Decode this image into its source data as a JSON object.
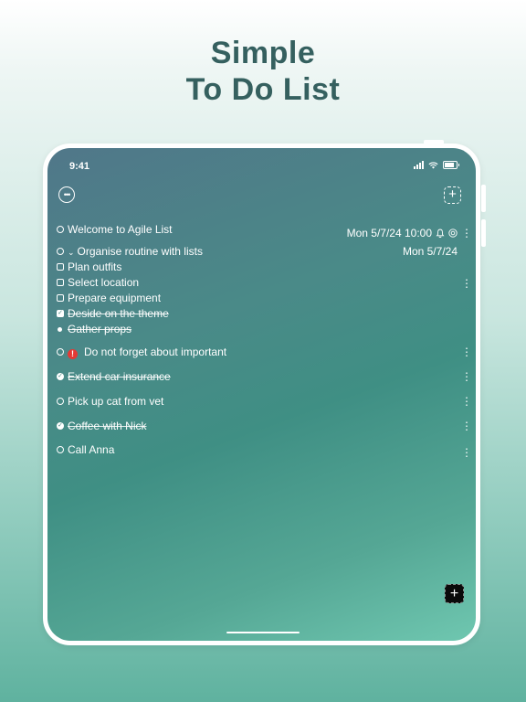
{
  "headline": {
    "line1": "Simple",
    "line2": "To Do List"
  },
  "status_bar": {
    "time": "9:41",
    "icons": [
      "signal-icon",
      "wifi-icon",
      "battery-icon"
    ]
  },
  "toolbar": {
    "more_icon": "ellipsis-icon",
    "add_icon": "plus-icon"
  },
  "tasks": [
    {
      "label": "Welcome to Agile List",
      "marker": "circle",
      "done": false,
      "date": "Mon 5/7/24 10:00",
      "has_alarm": true,
      "has_repeat": true
    },
    {
      "label": "Organise routine with lists",
      "marker": "circle",
      "done": false,
      "expanded": true,
      "date": "Mon 5/7/24"
    },
    {
      "label": "Plan outfits",
      "marker": "square",
      "done": false,
      "subtask": true
    },
    {
      "label": "Select location",
      "marker": "square",
      "done": false,
      "subtask": true
    },
    {
      "label": "Prepare equipment",
      "marker": "square",
      "done": false,
      "subtask": true
    },
    {
      "label": "Deside on the theme",
      "marker": "square",
      "done": true,
      "subtask": true
    },
    {
      "label": "Gather props",
      "marker": "dot",
      "done": true,
      "subtask": true
    },
    {
      "label": "Do not forget about important",
      "marker": "circle",
      "done": false,
      "important": true,
      "important_mark": "!"
    },
    {
      "label": "Extend car insurance",
      "marker": "circle",
      "done": true
    },
    {
      "label": "Pick up cat from vet",
      "marker": "circle",
      "done": false
    },
    {
      "label": "Coffee with Nick",
      "marker": "circle",
      "done": true
    },
    {
      "label": "Call Anna",
      "marker": "circle",
      "done": false
    }
  ],
  "colors": {
    "headline": "#35605f",
    "important": "#e53935"
  }
}
